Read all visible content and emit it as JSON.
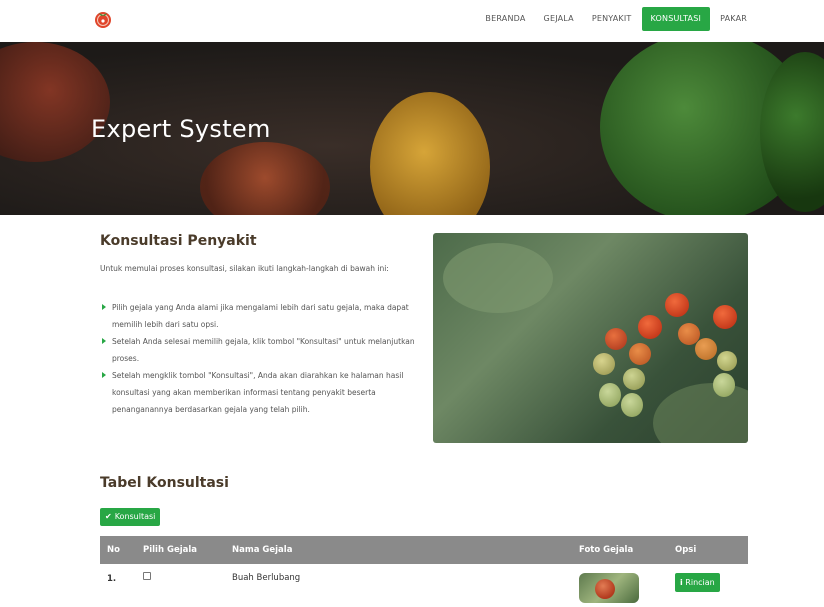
{
  "navbar": {
    "logo_icon": "tomato-logo-icon",
    "items": [
      {
        "label": "BERANDA",
        "active": false
      },
      {
        "label": "GEJALA",
        "active": false
      },
      {
        "label": "PENYAKIT",
        "active": false
      },
      {
        "label": "KONSULTASI",
        "active": true
      },
      {
        "label": "PAKAR",
        "active": false
      }
    ]
  },
  "hero": {
    "title": "Expert System"
  },
  "intro": {
    "title": "Konsultasi Penyakit",
    "lead": "Untuk memulai proses konsultasi, silakan ikuti langkah-langkah di bawah ini:",
    "steps": [
      "Pilih gejala yang Anda alami jika mengalami lebih dari satu gejala, maka dapat memilih lebih dari satu opsi.",
      "Setelah Anda selesai memilih gejala, klik tombol \"Konsultasi\" untuk melanjutkan proses.",
      "Setelah mengklik tombol \"Konsultasi\", Anda akan diarahkan ke halaman hasil konsultasi yang akan memberikan informasi tentang penyakit beserta penanganannya berdasarkan gejala yang telah pilih."
    ]
  },
  "table": {
    "title": "Tabel Konsultasi",
    "konsultasi_button": "Konsultasi",
    "headers": {
      "no": "No",
      "pilih": "Pilih Gejala",
      "nama": "Nama Gejala",
      "foto": "Foto Gejala",
      "opsi": "Opsi"
    },
    "rows": [
      {
        "no": "1.",
        "nama": "Buah Berlubang",
        "rincian_label": "Rincian",
        "checked": false
      }
    ]
  },
  "colors": {
    "accent": "#28a745",
    "heading": "#4a3b2a",
    "table_header": "#8a8a8a"
  }
}
